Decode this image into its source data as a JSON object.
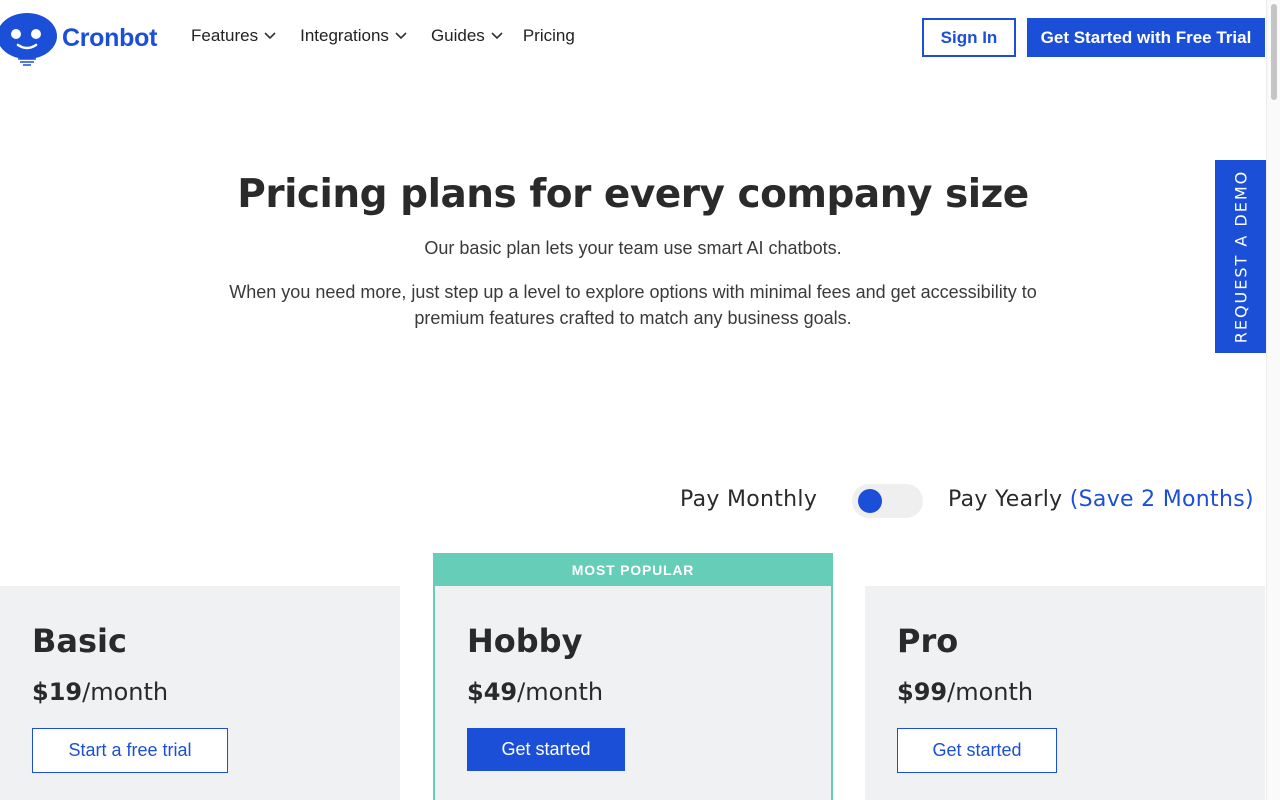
{
  "brand": {
    "name": "Cronbot",
    "accent_color": "#1c4fd8",
    "popular_color": "#66cdb8"
  },
  "nav": {
    "items": [
      {
        "label": "Features",
        "has_dropdown": true
      },
      {
        "label": "Integrations",
        "has_dropdown": true
      },
      {
        "label": "Guides",
        "has_dropdown": true
      },
      {
        "label": "Pricing",
        "has_dropdown": false
      }
    ],
    "sign_in_label": "Sign In",
    "trial_label": "Get Started with Free Trial"
  },
  "demo_tab": {
    "label": "REQUEST A DEMO"
  },
  "hero": {
    "title": "Pricing plans for every company size",
    "subtitle": "Our basic plan lets your team use smart AI chatbots.",
    "description": "When you need more, just step up a level to explore options with minimal fees and get accessibility to premium features crafted to match any business goals."
  },
  "billing": {
    "monthly_label": "Pay Monthly",
    "yearly_label": "Pay Yearly",
    "yearly_note": "(Save 2 Months)",
    "selected": "monthly"
  },
  "plans": [
    {
      "name": "Basic",
      "price": "$19",
      "period": "/month",
      "button_label": "Start a free trial",
      "button_style": "outline",
      "popular": false
    },
    {
      "name": "Hobby",
      "price": "$49",
      "period": "/month",
      "button_label": "Get started",
      "button_style": "solid",
      "popular": true,
      "popular_label": "MOST POPULAR"
    },
    {
      "name": "Pro",
      "price": "$99",
      "period": "/month",
      "button_label": "Get started",
      "button_style": "outline",
      "popular": false
    }
  ]
}
